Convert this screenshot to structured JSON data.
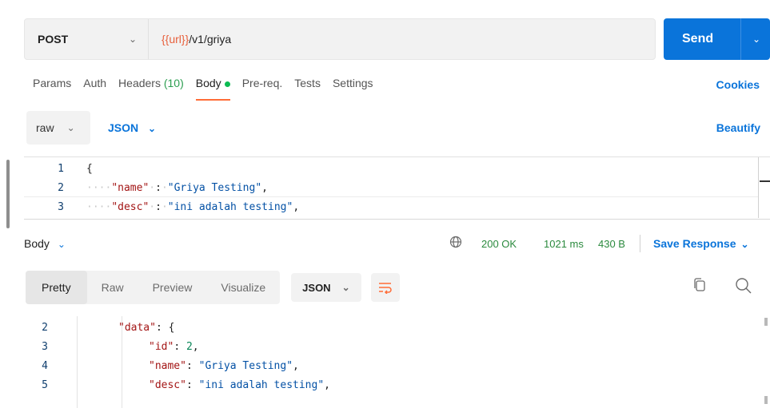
{
  "request": {
    "method": "POST",
    "url_var": "{{url}}",
    "url_path": "/v1/griya",
    "send_label": "Send"
  },
  "tabs": [
    {
      "label": "Params"
    },
    {
      "label": "Auth"
    },
    {
      "label": "Headers",
      "count": "(10)"
    },
    {
      "label": "Body"
    },
    {
      "label": "Pre-req."
    },
    {
      "label": "Tests"
    },
    {
      "label": "Settings"
    }
  ],
  "cookies_label": "Cookies",
  "body_options": {
    "mode": "raw",
    "language": "JSON",
    "beautify_label": "Beautify"
  },
  "request_body": [
    {
      "num": "1",
      "brace": "{"
    },
    {
      "num": "2",
      "key": "\"name\"",
      "value": "\"Griya Testing\""
    },
    {
      "num": "3",
      "key": "\"desc\"",
      "value": "\"ini adalah testing\""
    }
  ],
  "response_header": {
    "label": "Body",
    "status": "200 OK",
    "time": "1021 ms",
    "size": "430 B",
    "save_label": "Save Response"
  },
  "format_tabs": [
    {
      "label": "Pretty"
    },
    {
      "label": "Raw"
    },
    {
      "label": "Preview"
    },
    {
      "label": "Visualize"
    }
  ],
  "format_language": "JSON",
  "response_body": [
    {
      "num": "2",
      "key": "\"data\"",
      "punc": ": {"
    },
    {
      "num": "3",
      "key": "\"id\"",
      "number": "2"
    },
    {
      "num": "4",
      "key": "\"name\"",
      "value": "\"Griya Testing\""
    },
    {
      "num": "5",
      "key": "\"desc\"",
      "value": "\"ini adalah testing\""
    }
  ],
  "colors": {
    "accent_blue": "#0a74da",
    "tab_underline": "#ff6c37",
    "status_green": "#2b8a3e"
  }
}
